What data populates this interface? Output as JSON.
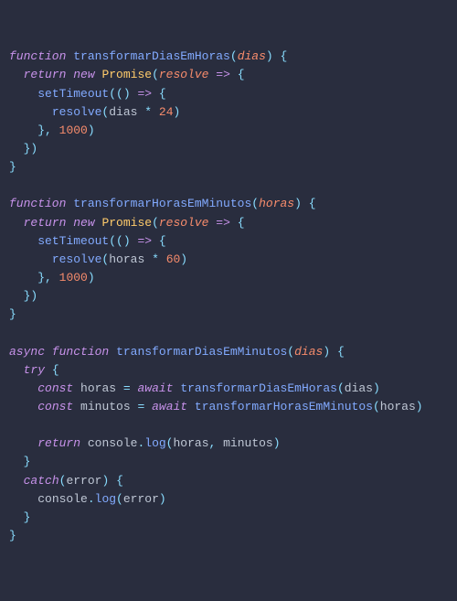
{
  "kw": {
    "function": "function",
    "return": "return",
    "new": "new",
    "async": "async",
    "try": "try",
    "catch": "catch",
    "const": "const",
    "await": "await"
  },
  "fn": {
    "transformarDiasEmHoras": "transformarDiasEmHoras",
    "transformarHorasEmMinutos": "transformarHorasEmMinutos",
    "transformarDiasEmMinutos": "transformarDiasEmMinutos",
    "setTimeout": "setTimeout",
    "resolve": "resolve",
    "log": "log"
  },
  "cls": {
    "Promise": "Promise"
  },
  "id": {
    "dias": "dias",
    "horas": "horas",
    "minutos": "minutos",
    "error": "error",
    "console": "console"
  },
  "num": {
    "n24": "24",
    "n60": "60",
    "n1000": "1000"
  },
  "pun": {
    "lp": "(",
    "rp": ")",
    "lb": "{",
    "rb": "}",
    "comma": ",",
    "dot": ".",
    "arrow": "=>",
    "star": "*",
    "eq": "="
  }
}
